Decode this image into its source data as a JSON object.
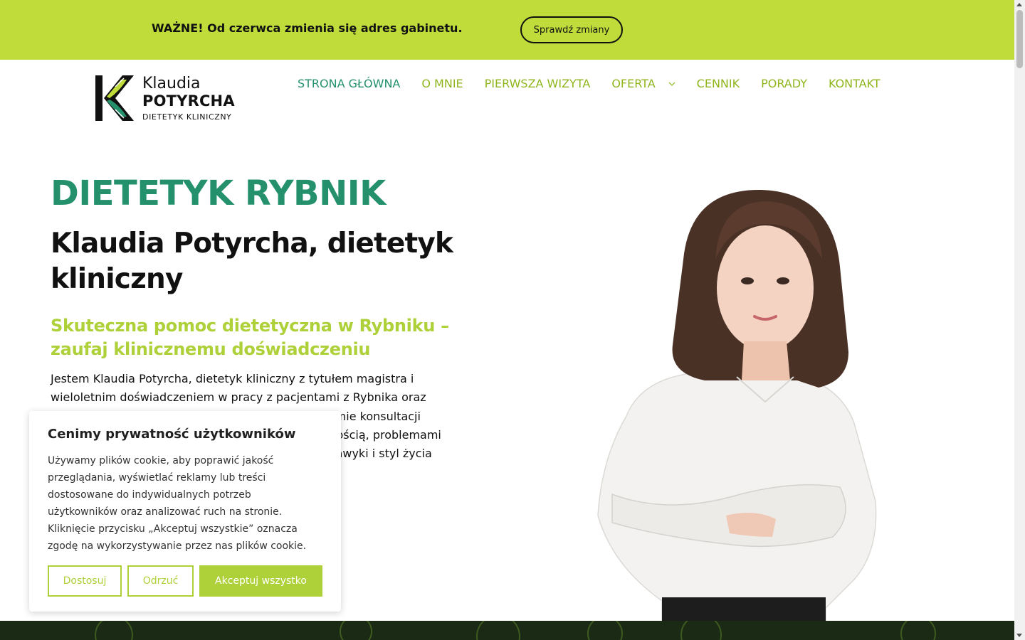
{
  "announcement": {
    "text": "WAŻNE! Od czerwca zmienia się adres gabinetu.",
    "button_label": "Sprawdź zmiany"
  },
  "logo": {
    "first_name": "Klaudia",
    "last_name": "POTYRCHA",
    "subtitle": "DIETETYK KLINICZNY"
  },
  "nav": {
    "items": [
      {
        "label": "STRONA GŁÓWNA",
        "active": true
      },
      {
        "label": "O MNIE"
      },
      {
        "label": "PIERWSZA WIZYTA"
      },
      {
        "label": "OFERTA",
        "has_dropdown": true
      },
      {
        "label": "CENNIK"
      },
      {
        "label": "PORADY"
      },
      {
        "label": "KONTAKT"
      }
    ]
  },
  "hero": {
    "title": "DIETETYK RYBNIK",
    "subtitle": "Klaudia Potyrcha, dietetyk kliniczny",
    "tagline": "Skuteczna pomoc dietetyczna w Rybniku – zaufaj klinicznemu doświadczeniu",
    "body": "Jestem Klaudia Potyrcha, dietetyk kliniczny z tytułem magistra i wieloletnim doświadczeniem w pracy z pacjentami z Rybnika oraz okolic. Pomagam zarówno stacjonarnie, jak i w formie konsultacji online osobom, które zmagają się z nadwagą, otyłością, problemami zdrowotnymi lub po prostu chcą poprawić swoje nawyki i styl życia zdrowego."
  },
  "cookie": {
    "title": "Cenimy prywatność użytkowników",
    "text": "Używamy plików cookie, aby poprawić jakość przeglądania, wyświetlać reklamy lub treści dostosowane do indywidualnych potrzeb użytkowników oraz analizować ruch na stronie. Kliknięcie przycisku „Akceptuj wszystkie” oznacza zgodę na wykorzystywanie przez nas plików cookie.",
    "customize_label": "Dostosuj",
    "reject_label": "Odrzuć",
    "accept_label": "Akceptuj wszystko"
  },
  "colors": {
    "brand_lime": "#bfdc3a",
    "brand_green": "#24906c",
    "accent_lime_text": "#aed038",
    "dark_footer": "#1b2a14"
  }
}
